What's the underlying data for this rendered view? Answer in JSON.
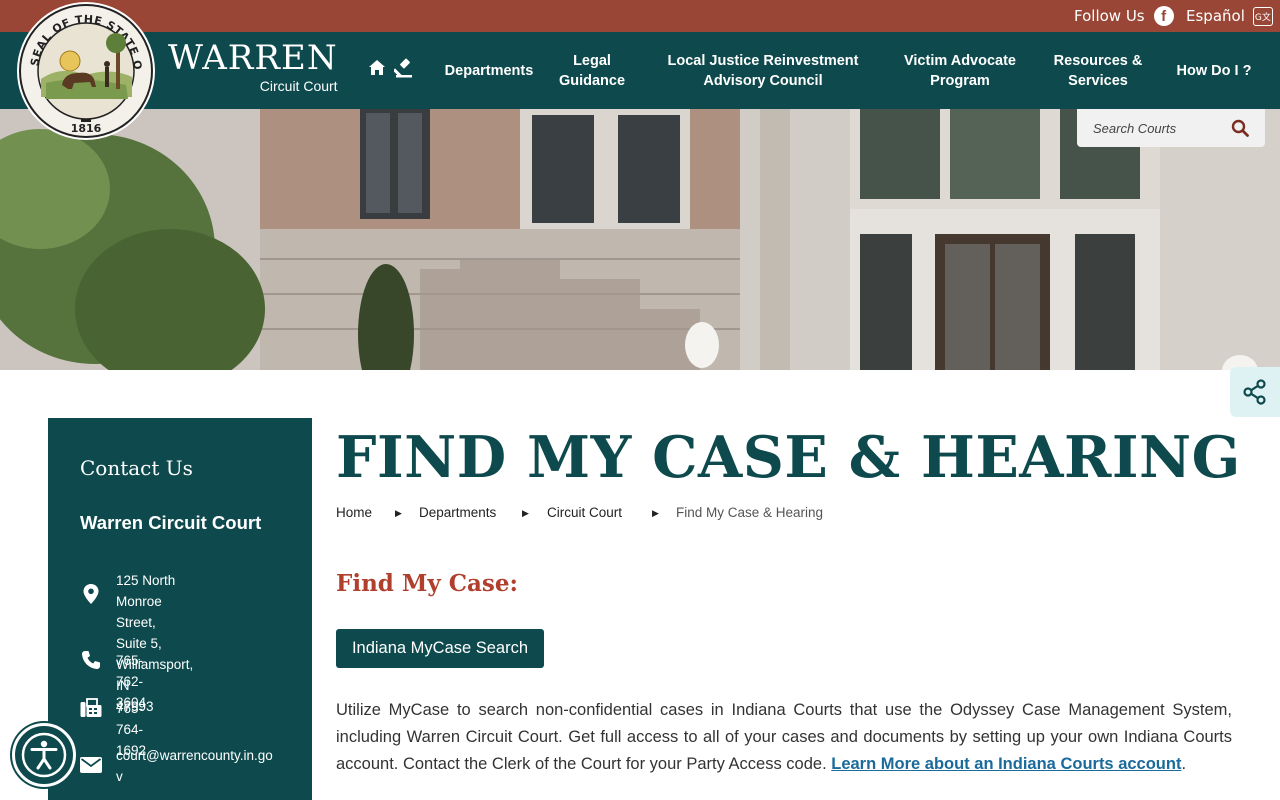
{
  "topbar": {
    "follow_label": "Follow Us",
    "language_label": "Español",
    "facebook_glyph": "f",
    "translate_glyph": "G文"
  },
  "brand": {
    "name": "WARREN",
    "subtitle": "Circuit Court",
    "seal_top_text": "SEAL OF THE STATE OF INDIANA",
    "seal_year": "1816"
  },
  "nav": {
    "items": [
      {
        "label": "Departments"
      },
      {
        "label": "Legal Guidance"
      },
      {
        "label": "Local Justice Reinvestment Advisory Council"
      },
      {
        "label": "Victim Advocate Program"
      },
      {
        "label": "Resources & Services"
      },
      {
        "label": "How Do I ?"
      }
    ],
    "icons": [
      "home-icon",
      "gavel-icon"
    ]
  },
  "search": {
    "placeholder": "Search Courts"
  },
  "sidebar": {
    "title": "Contact Us",
    "court_name": "Warren Circuit Court",
    "address": [
      "125 North Monroe Street,",
      "Suite 5, Williamsport, IN",
      "47993"
    ],
    "phone": "765-762-3604",
    "fax": "765-764-1692",
    "email": [
      "court@warrencounty.in.go",
      "v"
    ]
  },
  "main": {
    "title": "FIND MY CASE & HEARING",
    "breadcrumbs": [
      "Home",
      "Departments",
      "Circuit Court",
      "Find My Case & Hearing"
    ],
    "section_heading": "Find My Case:",
    "cta_label": "Indiana MyCase Search",
    "paragraph_text": "Utilize MyCase to search non-confidential cases in Indiana Courts that use the Odyssey Case Management System, including Warren Circuit Court. Get full access to all of your cases and documents by setting up your own Indiana Courts account.  Contact the Clerk of the Court for your Party Access code.",
    "paragraph_link": "Learn More about an Indiana Courts account",
    "paragraph_end": "."
  },
  "colors": {
    "topbar": "#9a4636",
    "primary": "#0e4a4d",
    "heading_accent": "#b0402d",
    "link": "#1a6a9c"
  }
}
